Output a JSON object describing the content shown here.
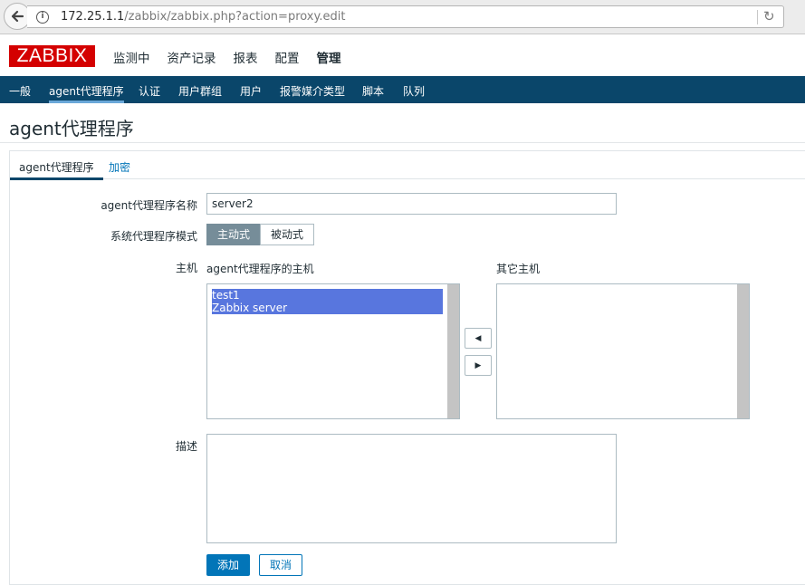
{
  "browser": {
    "url_host": "172.25.1.1",
    "url_path": "/zabbix/zabbix.php?action=proxy.edit"
  },
  "header": {
    "logo": "ZABBIX",
    "menu": [
      "监测中",
      "资产记录",
      "报表",
      "配置",
      "管理"
    ],
    "active_menu": "管理"
  },
  "subnav": {
    "items": [
      "一般",
      "agent代理程序",
      "认证",
      "用户群组",
      "用户",
      "报警媒介类型",
      "脚本",
      "队列"
    ],
    "active": "agent代理程序"
  },
  "page": {
    "title": "agent代理程序"
  },
  "tabs": [
    "agent代理程序",
    "加密"
  ],
  "form": {
    "name_label": "agent代理程序名称",
    "name_value": "server2",
    "mode_label": "系统代理程序模式",
    "mode_active": "主动式",
    "mode_passive": "被动式",
    "hosts_label": "主机",
    "proxy_hosts_title": "agent代理程序的主机",
    "proxy_hosts": [
      "test1",
      "Zabbix server"
    ],
    "other_hosts_title": "其它主机",
    "other_hosts": [],
    "description_label": "描述",
    "description_value": "",
    "add_button": "添加",
    "cancel_button": "取消"
  },
  "colors": {
    "subnav_bg": "#0a466a",
    "logo_red": "#d40000",
    "primary": "#0275b8",
    "selected_option": "#5876de",
    "active_segment": "#768d99"
  }
}
